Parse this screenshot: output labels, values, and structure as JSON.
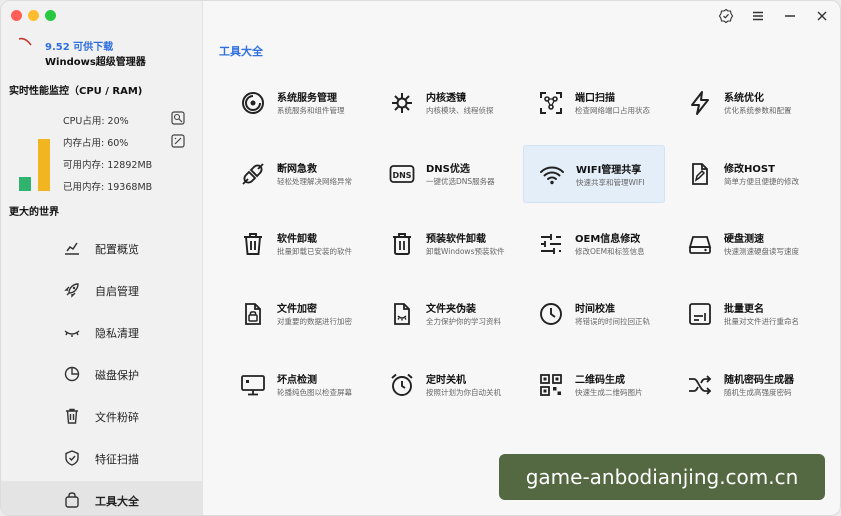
{
  "app": {
    "version": "9.52 可供下载",
    "name": "Windows超级管理器"
  },
  "monitor": {
    "title": "实时性能监控（CPU / RAM)",
    "cpu_label": "CPU占用: 20%",
    "ram_label": "内存占用: 60%",
    "available_label": "可用内存: 12892MB",
    "used_label": "已用内存: 19368MB",
    "cpu_percent": 20,
    "ram_percent": 60,
    "cpu_color": "#2fb36d",
    "ram_color": "#f0b521"
  },
  "sidebar": {
    "section_title": "更大的世界",
    "items": [
      {
        "label": "配置概览",
        "icon": "chart-icon"
      },
      {
        "label": "自启管理",
        "icon": "rocket-icon"
      },
      {
        "label": "隐私清理",
        "icon": "eye-closed-icon"
      },
      {
        "label": "磁盘保护",
        "icon": "pie-icon"
      },
      {
        "label": "文件粉碎",
        "icon": "trash-icon"
      },
      {
        "label": "特征扫描",
        "icon": "shield-icon"
      },
      {
        "label": "工具大全",
        "icon": "bag-icon"
      }
    ]
  },
  "main": {
    "title": "工具大全",
    "accent": "#2f6fe0"
  },
  "tools": [
    {
      "name": "系统服务管理",
      "desc": "系统服务和组件管理"
    },
    {
      "name": "内核透镜",
      "desc": "内核模块、线程侦探"
    },
    {
      "name": "端口扫描",
      "desc": "检查网络端口占用状态"
    },
    {
      "name": "系统优化",
      "desc": "优化系统参数和配置"
    },
    {
      "name": "断网急救",
      "desc": "轻松处理解决网络异常"
    },
    {
      "name": "DNS优选",
      "desc": "一键优选DNS服务器"
    },
    {
      "name": "WIFI管理共享",
      "desc": "快速共享和管理WIFI"
    },
    {
      "name": "修改HOST",
      "desc": "简单方便且便捷的修改"
    },
    {
      "name": "软件卸载",
      "desc": "批量卸载已安装的软件"
    },
    {
      "name": "预装软件卸载",
      "desc": "卸载Windows预装软件"
    },
    {
      "name": "OEM信息修改",
      "desc": "修改OEM和标签信息"
    },
    {
      "name": "硬盘测速",
      "desc": "快速测速硬盘读写速度"
    },
    {
      "name": "文件加密",
      "desc": "对重要的数据进行加密"
    },
    {
      "name": "文件夹伪装",
      "desc": "全力保护你的学习资料"
    },
    {
      "name": "时间校准",
      "desc": "将错误的时间拉回正轨"
    },
    {
      "name": "批量更名",
      "desc": "批量对文件进行重命名"
    },
    {
      "name": "坏点检测",
      "desc": "轮播纯色图以检查屏幕"
    },
    {
      "name": "定时关机",
      "desc": "按照计划为你自动关机"
    },
    {
      "name": "二维码生成",
      "desc": "快速生成二维码图片"
    },
    {
      "name": "随机密码生成器",
      "desc": "随机生成高强度密码"
    }
  ],
  "watermark": "game-anbodianjing.com.cn"
}
